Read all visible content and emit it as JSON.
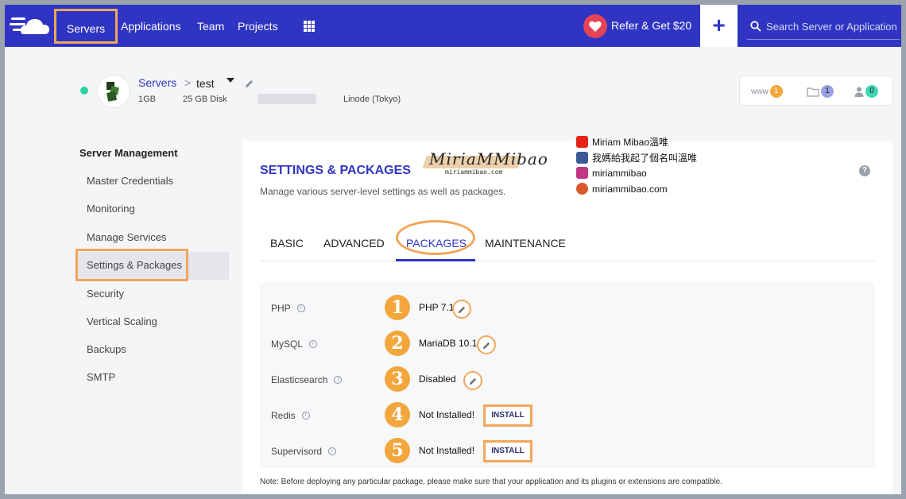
{
  "topnav": {
    "items": [
      "Servers",
      "Applications",
      "Team",
      "Projects"
    ],
    "refer_label": "Refer & Get $20",
    "plus_label": "+",
    "search_placeholder": "Search Server or Application"
  },
  "server": {
    "breadcrumb_root": "Servers",
    "breadcrumb_sep": ">",
    "name": "test",
    "ram": "1GB",
    "disk": "25 GB Disk",
    "location": "Linode (Tokyo)",
    "stats": [
      {
        "label": "www",
        "count": "1",
        "color": "#f3a63b"
      },
      {
        "label": "",
        "count": "1",
        "color": "#9aa0e0"
      },
      {
        "label": "",
        "count": "0",
        "color": "#3fd6b3"
      }
    ]
  },
  "sidebar": {
    "title": "Server Management",
    "items": [
      "Master Credentials",
      "Monitoring",
      "Manage Services",
      "Settings & Packages",
      "Security",
      "Vertical Scaling",
      "Backups",
      "SMTP"
    ]
  },
  "card": {
    "title": "SETTINGS & PACKAGES",
    "subtitle": "Manage various server-level settings as well as packages.",
    "tabs": [
      "BASIC",
      "ADVANCED",
      "PACKAGES",
      "MAINTENANCE"
    ],
    "note": "Note: Before deploying any particular package, please make sure that your application and its plugins or extensions are compatible."
  },
  "watermark": {
    "logo_main": "MiriaMMibao",
    "logo_sub": "miriammibao.com",
    "social": [
      {
        "icon": "youtube-icon",
        "text": "Miriam Mibao溫唯",
        "color": "#e62117"
      },
      {
        "icon": "facebook-icon",
        "text": "我媽給我起了個名叫溫唯",
        "color": "#3b5998"
      },
      {
        "icon": "instagram-icon",
        "text": "miriammibao",
        "color": "#c13584"
      },
      {
        "icon": "globe-icon",
        "text": "miriammibao.com",
        "color": "#d9572b"
      }
    ]
  },
  "packages": [
    {
      "num": "1",
      "label": "PHP",
      "value": "PHP 7.1",
      "action": "edit"
    },
    {
      "num": "2",
      "label": "MySQL",
      "value": "MariaDB 10.1",
      "action": "edit"
    },
    {
      "num": "3",
      "label": "Elasticsearch",
      "value": "Disabled",
      "action": "edit"
    },
    {
      "num": "4",
      "label": "Redis",
      "value": "Not Installed!",
      "action": "INSTALL"
    },
    {
      "num": "5",
      "label": "Supervisord",
      "value": "Not Installed!",
      "action": "INSTALL"
    }
  ],
  "colors": {
    "brand": "#2f35c2",
    "highlight": "#f2a65a",
    "status_online": "#2ed1a2"
  }
}
